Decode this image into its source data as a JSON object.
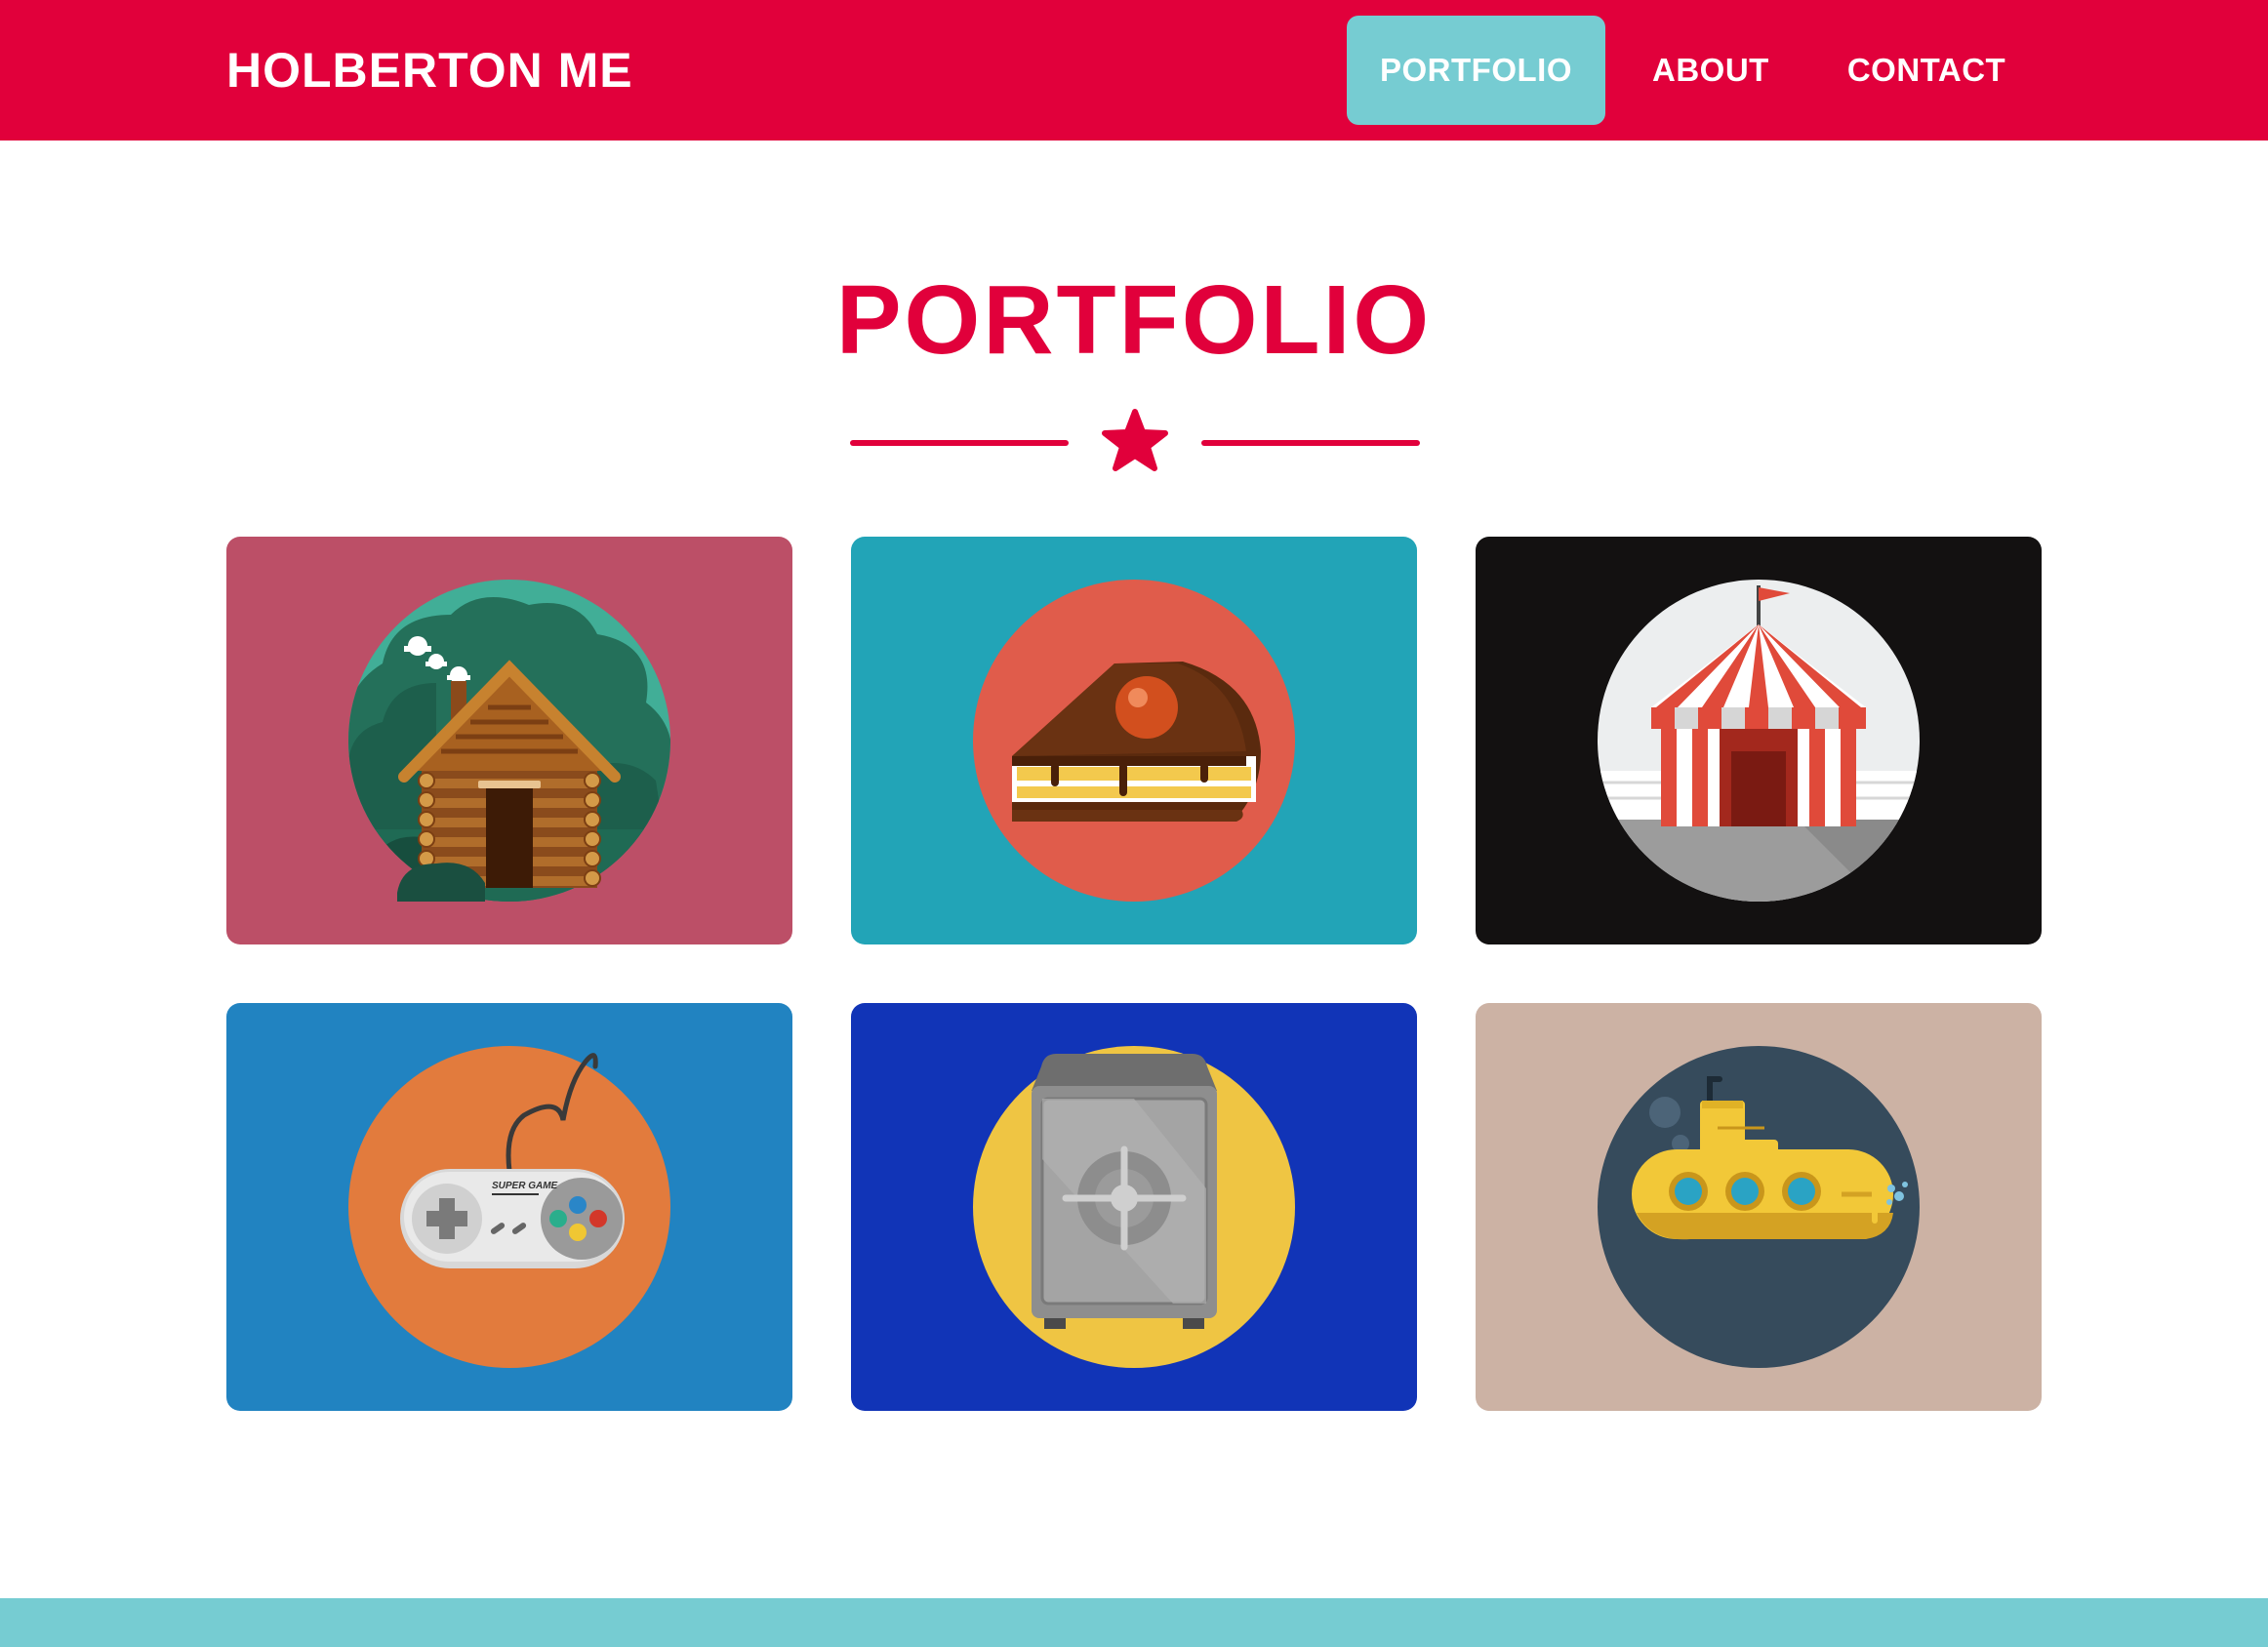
{
  "header": {
    "brand": "HOLBERTON ME",
    "nav": [
      {
        "label": "PORTFOLIO",
        "active": true
      },
      {
        "label": "ABOUT",
        "active": false
      },
      {
        "label": "CONTACT",
        "active": false
      }
    ]
  },
  "main": {
    "title": "PORTFOLIO",
    "divider_icon": "star-icon"
  },
  "portfolio": [
    {
      "icon": "log-cabin-icon",
      "background": "#bc4f67",
      "circle": "#41ae97"
    },
    {
      "icon": "cake-slice-icon",
      "background": "#22a4b7",
      "circle": "#e05c4b"
    },
    {
      "icon": "circus-tent-icon",
      "background": "#131111",
      "circle": "#eceeef"
    },
    {
      "icon": "game-controller-icon",
      "background": "#2183c1",
      "circle": "#e27b3d"
    },
    {
      "icon": "safe-icon",
      "background": "#1134b7",
      "circle": "#efc543"
    },
    {
      "icon": "submarine-icon",
      "background": "#ccb2a4",
      "circle": "#364b5c"
    }
  ],
  "colors": {
    "brand": "#e1003b",
    "active_nav": "#76ccd2",
    "footer": "#76ccd2",
    "background": "#ffffff"
  },
  "controller_text": "SUPER GAME"
}
